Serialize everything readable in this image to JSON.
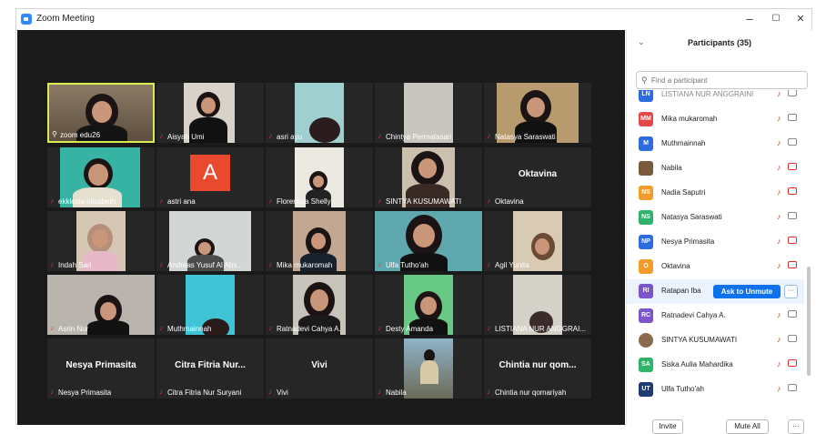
{
  "window": {
    "title": "Zoom Meeting",
    "minimize": "–",
    "maximize": "☐",
    "close": "✕"
  },
  "tiles": [
    {
      "name": "zoom edu26",
      "center": "",
      "active": true
    },
    {
      "name": "Aisyah Umi",
      "center": ""
    },
    {
      "name": "asri ayu",
      "center": ""
    },
    {
      "name": "Chintya Permatasari",
      "center": ""
    },
    {
      "name": "Natasya Saraswati",
      "center": ""
    },
    {
      "name": "ekklesia elisabeth",
      "center": ""
    },
    {
      "name": "astri ana",
      "center": "",
      "avatar_letter": "A"
    },
    {
      "name": "Florentina Shelly",
      "center": ""
    },
    {
      "name": "SINTYA KUSUMAWATI",
      "center": ""
    },
    {
      "name": "Oktavina",
      "center": "Oktavina"
    },
    {
      "name": "Indah Sari",
      "center": ""
    },
    {
      "name": "Andreas Yusuf Al Abs...",
      "center": ""
    },
    {
      "name": "Mika mukaromah",
      "center": ""
    },
    {
      "name": "Ulfa Tutho'ah",
      "center": ""
    },
    {
      "name": "Agil Yunita",
      "center": ""
    },
    {
      "name": "Asrin Nur",
      "center": ""
    },
    {
      "name": "Muthmainnah",
      "center": ""
    },
    {
      "name": "Ratnadevi Cahya A.",
      "center": ""
    },
    {
      "name": "Desty Amanda",
      "center": ""
    },
    {
      "name": "LISTIANA NUR ANGGRAI...",
      "center": ""
    },
    {
      "name": "Nesya Primasita",
      "center": "Nesya Primasita"
    },
    {
      "name": "Citra Fitria Nur Suryani",
      "center": "Citra Fitria Nur..."
    },
    {
      "name": "Vivi",
      "center": "Vivi"
    },
    {
      "name": "Nabila",
      "center": ""
    },
    {
      "name": "Chintia nur qomariyah",
      "center": "Chintia nur qom..."
    }
  ],
  "panel": {
    "title": "Participants (35)",
    "search_placeholder": "Find a participant",
    "participants": [
      {
        "initials": "LN",
        "name": "LISTIANA NUR ANGGRAINI",
        "color": "#2d6cdf",
        "cam_off": false
      },
      {
        "initials": "MM",
        "name": "Mika mukaromah",
        "color": "#e54848",
        "cam_off": false
      },
      {
        "initials": "M",
        "name": "Muthmainnah",
        "color": "#2d6cdf",
        "cam_off": false
      },
      {
        "initials": "",
        "name": "Nabila",
        "color": "#7a5a3a",
        "cam_off": true
      },
      {
        "initials": "NS",
        "name": "Nadia Saputri",
        "color": "#f39c2a",
        "cam_off": true
      },
      {
        "initials": "NS",
        "name": "Natasya Saraswati",
        "color": "#2fb36b",
        "cam_off": false
      },
      {
        "initials": "NP",
        "name": "Nesya Primasita",
        "color": "#2d6cdf",
        "cam_off": true
      },
      {
        "initials": "O",
        "name": "Oktavina",
        "color": "#f39c2a",
        "cam_off": true
      },
      {
        "initials": "RI",
        "name": "Ratapan Iba",
        "color": "#7b55c9",
        "highlight": true,
        "unmute_label": "Ask to Unmute",
        "more": "···"
      },
      {
        "initials": "RC",
        "name": "Ratnadevi Cahya A.",
        "color": "#7b55c9",
        "cam_off": false
      },
      {
        "initials": "",
        "name": "SINTYA KUSUMAWATI",
        "color": "#8a6a4a",
        "cam_off": false
      },
      {
        "initials": "SA",
        "name": "Siska Aulia Mahardika",
        "color": "#2fb36b",
        "cam_off": true
      },
      {
        "initials": "UT",
        "name": "Ulfa Tutho'ah",
        "color": "#1e3c72",
        "cam_off": false
      },
      {
        "initials": "",
        "name": "",
        "color": "#f39c2a",
        "cam_off": true
      }
    ],
    "invite": "Invite",
    "mute_all": "Mute All",
    "more": "···"
  },
  "colors": {
    "accent": "#0e72ed",
    "active_speaker": "#d6ec4f"
  }
}
